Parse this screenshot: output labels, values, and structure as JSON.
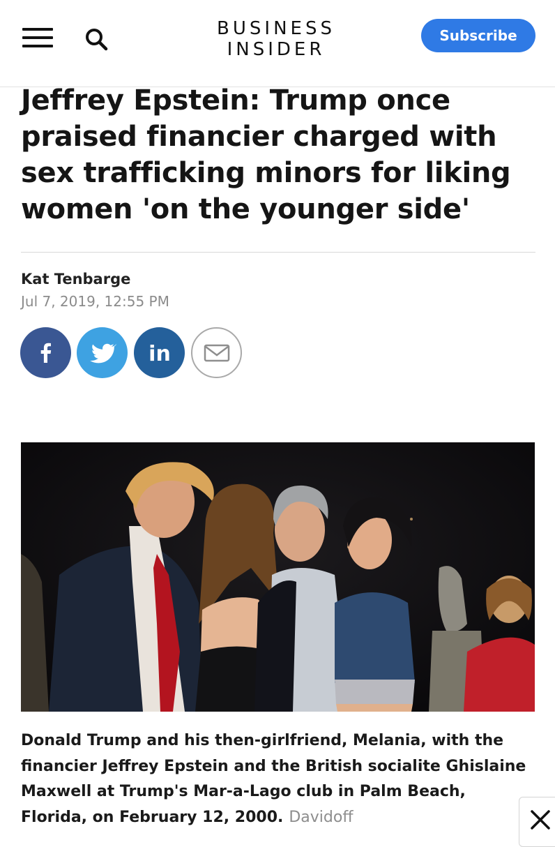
{
  "header": {
    "logo_line1": "BUSINESS",
    "logo_line2": "INSIDER",
    "subscribe_label": "Subscribe",
    "accent_color": "#2f7ae5"
  },
  "article": {
    "headline": "Jeffrey Epstein: Trump once praised financier charged with sex trafficking minors for liking women 'on the younger side'",
    "author": "Kat Tenbarge",
    "date": "Jul 7, 2019, 12:55 PM",
    "share": [
      {
        "network": "facebook",
        "icon": "facebook-icon",
        "color": "#3a5793"
      },
      {
        "network": "twitter",
        "icon": "twitter-icon",
        "color": "#3ea2e2"
      },
      {
        "network": "linkedin",
        "icon": "linkedin-icon",
        "color": "#24609b"
      },
      {
        "network": "email",
        "icon": "email-icon",
        "color": "#a9a9a9"
      }
    ],
    "photo": {
      "subject": "Donald Trump, Melania, Jeffrey Epstein and Ghislaine Maxwell at Mar-a-Lago"
    },
    "caption": "Donald Trump and his then-girlfriend, Melania, with the financier Jeffrey Epstein and the British socialite Ghislaine Maxwell at Trump's Mar-a-Lago club in Palm Beach, Florida, on February 12, 2000.",
    "credit": "Davidoff"
  },
  "overlay": {
    "close_icon": "close-icon"
  }
}
